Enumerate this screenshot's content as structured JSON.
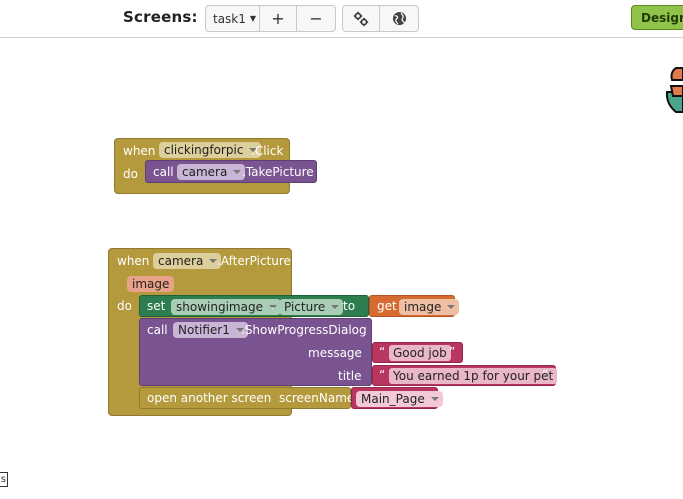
{
  "toolbar": {
    "screens_label": "Screens:",
    "screen_selector": "task1",
    "add_screen": "+",
    "remove_screen": "−",
    "designer_button": "Designe"
  },
  "blocks": {
    "block1": {
      "when": "when",
      "component": "clickingforpic",
      "event": ".Click",
      "do": "do",
      "call": "call",
      "call_component": "camera",
      "method": ".TakePicture"
    },
    "block2": {
      "when": "when",
      "component": "camera",
      "event": ".AfterPicture",
      "param": "image",
      "do": "do",
      "set": "set",
      "set_component": "showingimage",
      "property": "Picture",
      "to": "to",
      "get": "get",
      "get_var": "image",
      "call": "call",
      "call_component": "Notifier1",
      "method": ".ShowProgressDialog",
      "message_label": "message",
      "message_value": "Good job",
      "title_label": "title",
      "title_value": "You earned 1p for your pet",
      "open_screen": "open another screen  screenName",
      "screen_name": "Main_Page"
    }
  },
  "workspace": {
    "corner_label": "s"
  }
}
